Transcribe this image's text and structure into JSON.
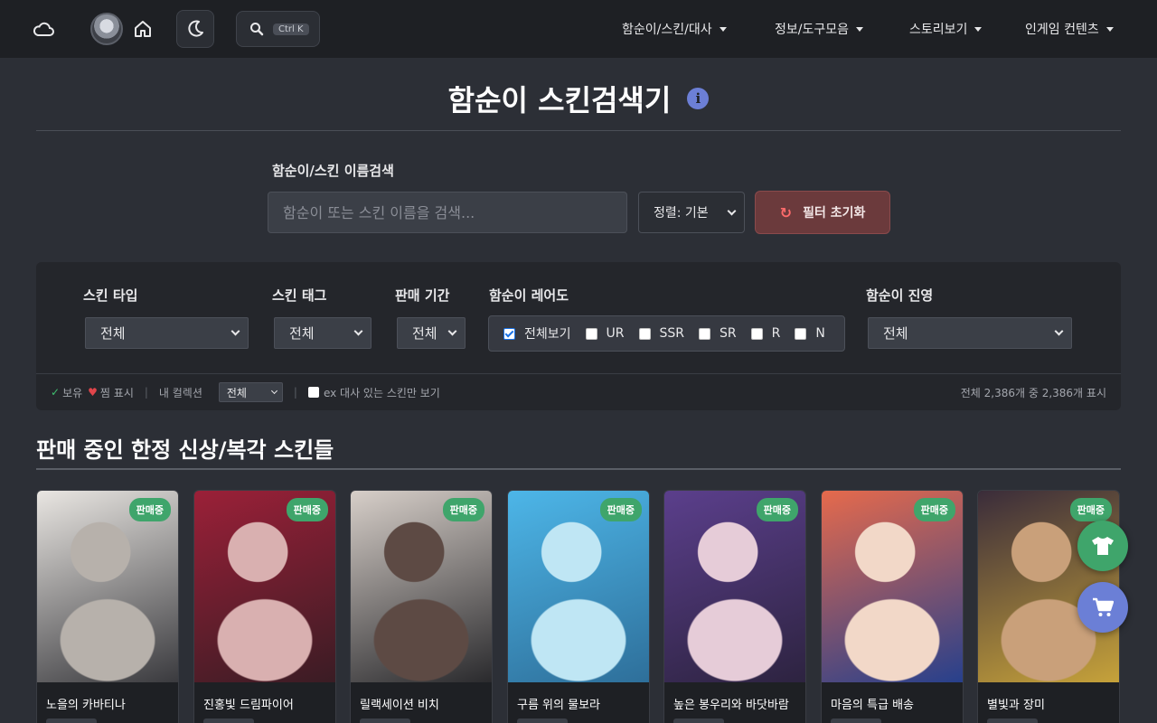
{
  "nav": {
    "search_shortcut": "Ctrl K",
    "menus": [
      {
        "label": "함순이/스킨/대사"
      },
      {
        "label": "정보/도구모음"
      },
      {
        "label": "스토리보기"
      },
      {
        "label": "인게임 컨텐츠"
      }
    ]
  },
  "page": {
    "title": "함순이 스킨검색기"
  },
  "search": {
    "label": "함순이/스킨 이름검색",
    "placeholder": "함순이 또는 스킨 이름을 검색...",
    "sort_value": "정렬: 기본",
    "reset_label": "필터 초기화"
  },
  "filters": {
    "skin_type": {
      "label": "스킨 타입",
      "value": "전체"
    },
    "skin_tag": {
      "label": "스킨 태그",
      "value": "전체"
    },
    "sale_period": {
      "label": "판매 기간",
      "value": "전체"
    },
    "rarity": {
      "label": "함순이 레어도",
      "options": [
        {
          "label": "전체보기",
          "checked": true
        },
        {
          "label": "UR",
          "checked": false
        },
        {
          "label": "SSR",
          "checked": false
        },
        {
          "label": "SR",
          "checked": false
        },
        {
          "label": "R",
          "checked": false
        },
        {
          "label": "N",
          "checked": false
        }
      ]
    },
    "faction": {
      "label": "함순이 진영",
      "value": "전체"
    },
    "footer": {
      "owned": "보유",
      "wish": "찜 표시",
      "collection_label": "내 컬렉션",
      "collection_value": "전체",
      "ex_only": "ex 대사 있는 스킨만 보기",
      "count": "전체 2,386개 중 2,386개 표시"
    }
  },
  "section": {
    "title": "판매 중인 한정 신상/복각 스킨들"
  },
  "cards": [
    {
      "name": "노을의 카바티나",
      "badge": "판매중",
      "colors": [
        "#e9e6e2",
        "#b7b1ab",
        "#3a3a3e"
      ]
    },
    {
      "name": "진홍빛 드림파이어",
      "badge": "판매중",
      "colors": [
        "#9b2038",
        "#d9b0b0",
        "#3a1c24"
      ]
    },
    {
      "name": "릴랙세이션 비치",
      "badge": "판매중",
      "colors": [
        "#d7cfc9",
        "#5d4a44",
        "#2a2a2d"
      ]
    },
    {
      "name": "구름 위의 물보라",
      "badge": "판매중",
      "colors": [
        "#4db6e8",
        "#bfe6f4",
        "#2e6f9a"
      ]
    },
    {
      "name": "높은 봉우리와 바닷바람",
      "badge": "판매중",
      "colors": [
        "#5b3f8c",
        "#e6ccd8",
        "#2d2340"
      ]
    },
    {
      "name": "마음의 특급 배송",
      "badge": "판매중",
      "colors": [
        "#e66a4c",
        "#f2d8c8",
        "#27408c"
      ]
    },
    {
      "name": "별빛과 장미",
      "badge": "판매중",
      "colors": [
        "#3a2c3a",
        "#c9a07a",
        "#c6a23a"
      ]
    }
  ]
}
